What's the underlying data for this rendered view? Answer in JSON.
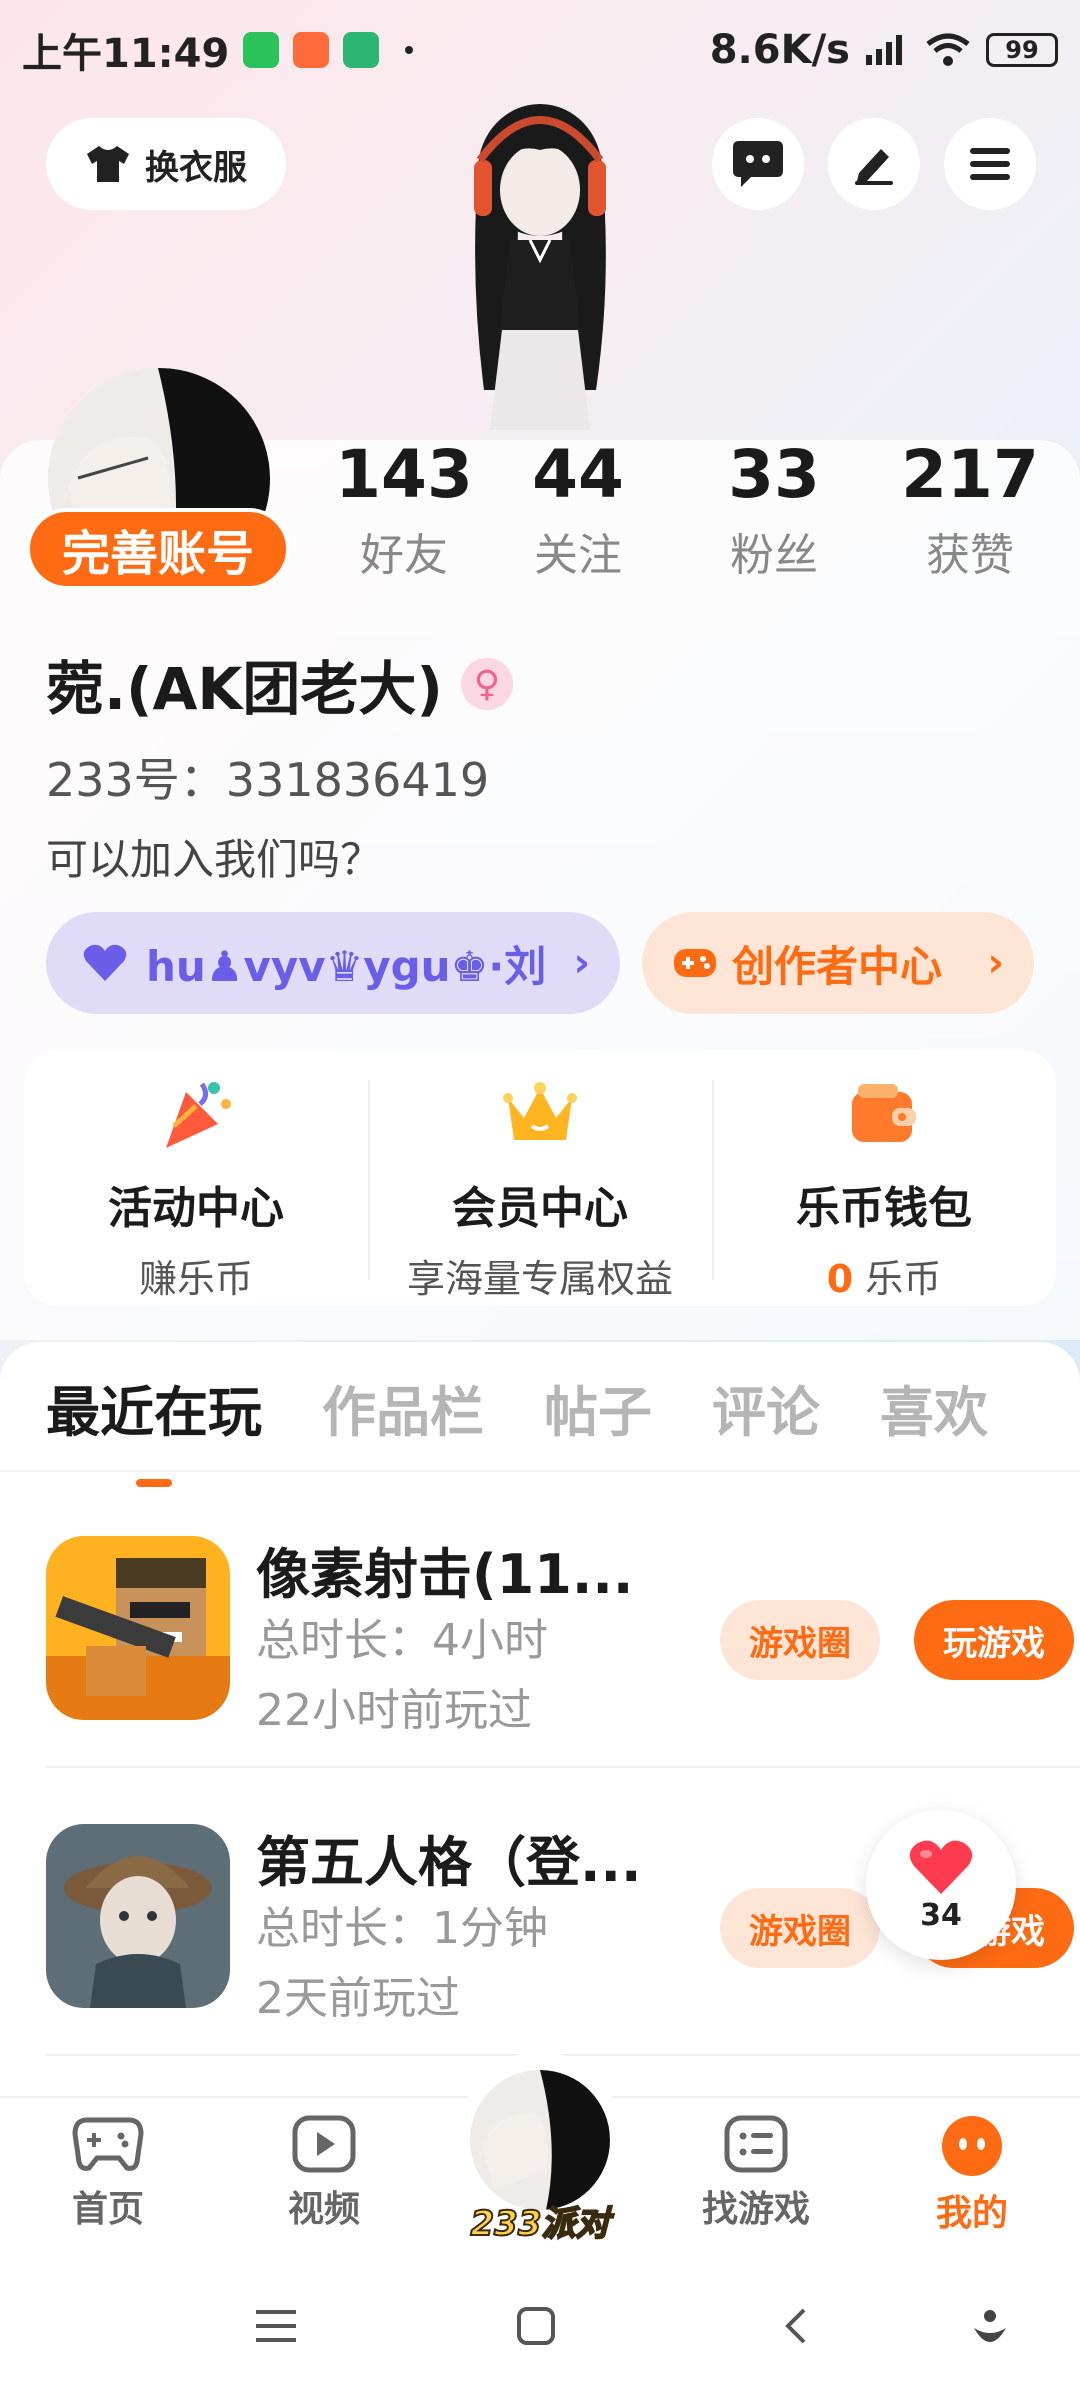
{
  "status_bar": {
    "time": "上午11:49",
    "speed": "8.6K/s",
    "battery": "99"
  },
  "header": {
    "outfit_label": "换衣服"
  },
  "profile": {
    "fix_account_label": "完善账号",
    "stats": [
      {
        "value": "143",
        "label": "好友"
      },
      {
        "value": "44",
        "label": "关注"
      },
      {
        "value": "33",
        "label": "粉丝"
      },
      {
        "value": "217",
        "label": "获赞"
      }
    ],
    "nickname": "菀.(AK团老大)",
    "gender_symbol": "♀",
    "uid": "233号：331836419",
    "bio": "可以加入我们吗？",
    "group_tag": "hu♟vyv♛ygu♚·刘",
    "creator_center": "创作者中心"
  },
  "quick_links": [
    {
      "title": "活动中心",
      "subtitle": "赚乐币",
      "icon": "party-popper-icon"
    },
    {
      "title": "会员中心",
      "subtitle": "享海量专属权益",
      "icon": "crown-icon"
    },
    {
      "title": "乐币钱包",
      "subtitle_value": "0",
      "subtitle_unit": "乐币",
      "icon": "wallet-icon"
    }
  ],
  "tabs": [
    "最近在玩",
    "作品栏",
    "帖子",
    "评论",
    "喜欢"
  ],
  "games": [
    {
      "name": "像素射击(11...",
      "duration": "总时长：4小时",
      "last_played": "22小时前玩过",
      "circle_btn": "游戏圈",
      "play_btn": "玩游戏"
    },
    {
      "name": "第五人格（登...",
      "duration": "总时长：1分钟",
      "last_played": "2天前玩过",
      "circle_btn": "游戏圈",
      "play_btn": "玩游戏"
    }
  ],
  "like_fab": {
    "count": "34"
  },
  "bottom_nav": {
    "home": "首页",
    "video": "视频",
    "center": "233派对",
    "find_games": "找游戏",
    "mine": "我的"
  },
  "colors": {
    "accent": "#ff6b12",
    "purple": "#6a5ee8"
  }
}
